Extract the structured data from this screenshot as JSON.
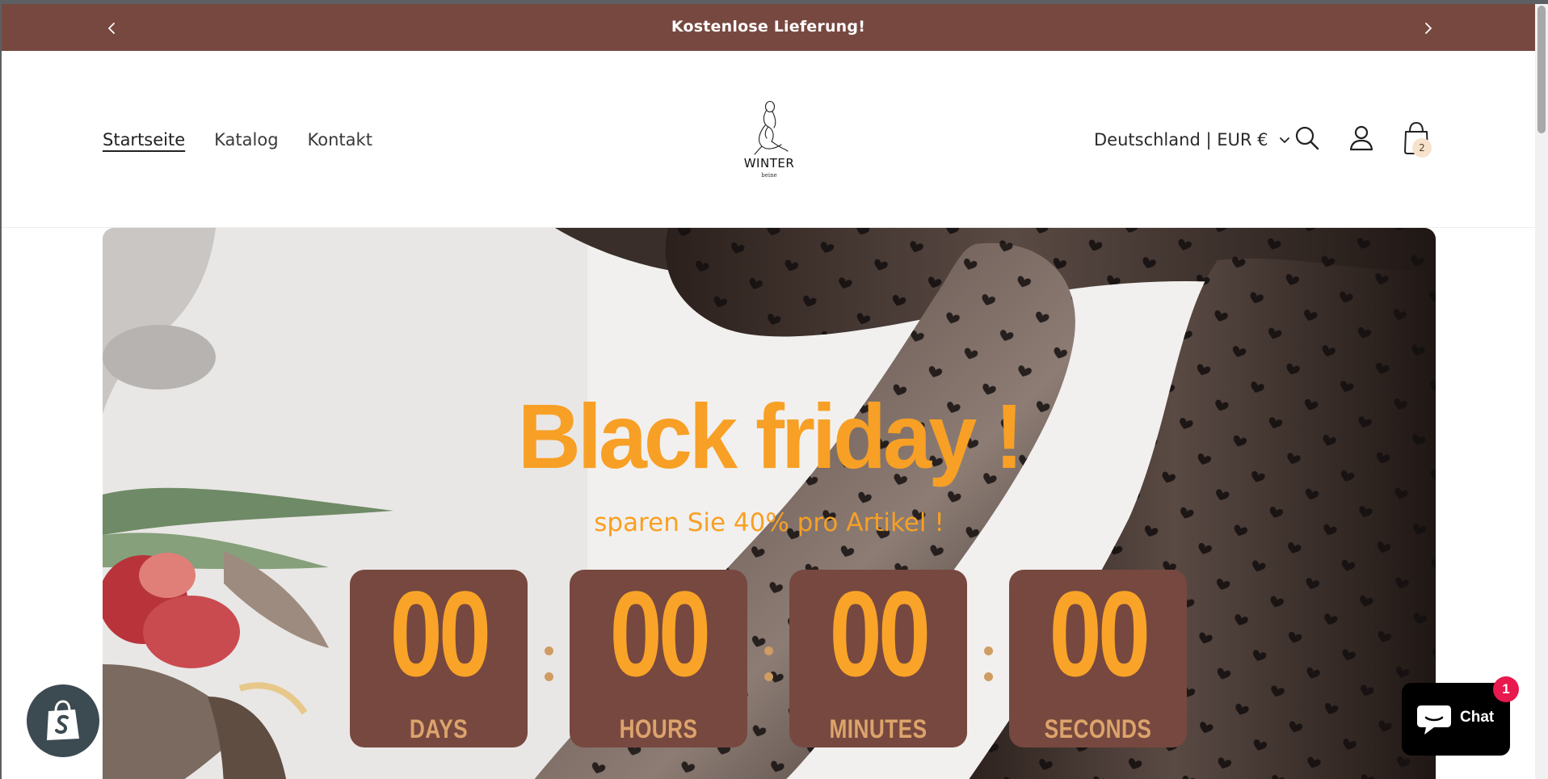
{
  "announcement": {
    "text": "Kostenlose Lieferung!",
    "prev_icon": "chevron-left-icon",
    "next_icon": "chevron-right-icon"
  },
  "nav": {
    "items": [
      {
        "label": "Startseite",
        "active": true
      },
      {
        "label": "Katalog",
        "active": false
      },
      {
        "label": "Kontakt",
        "active": false
      }
    ]
  },
  "logo": {
    "line1": "WINTER",
    "line2": "beine"
  },
  "header": {
    "country": "Deutschland | EUR €",
    "cart_count": "2",
    "icons": [
      "search-icon",
      "account-icon",
      "cart-icon"
    ]
  },
  "hero": {
    "headline": "Black friday !",
    "subline": "sparen Sie 40% pro Artikel !",
    "countdown": [
      {
        "value": "00",
        "label": "DAYS"
      },
      {
        "value": "00",
        "label": "HOURS"
      },
      {
        "value": "00",
        "label": "MINUTES"
      },
      {
        "value": "00",
        "label": "SECONDS"
      }
    ]
  },
  "chat": {
    "label": "Chat",
    "badge": "1"
  },
  "colors": {
    "brand": "#77483f",
    "accent": "#f7a025",
    "label": "#dca36b",
    "badge": "#e8194d"
  }
}
